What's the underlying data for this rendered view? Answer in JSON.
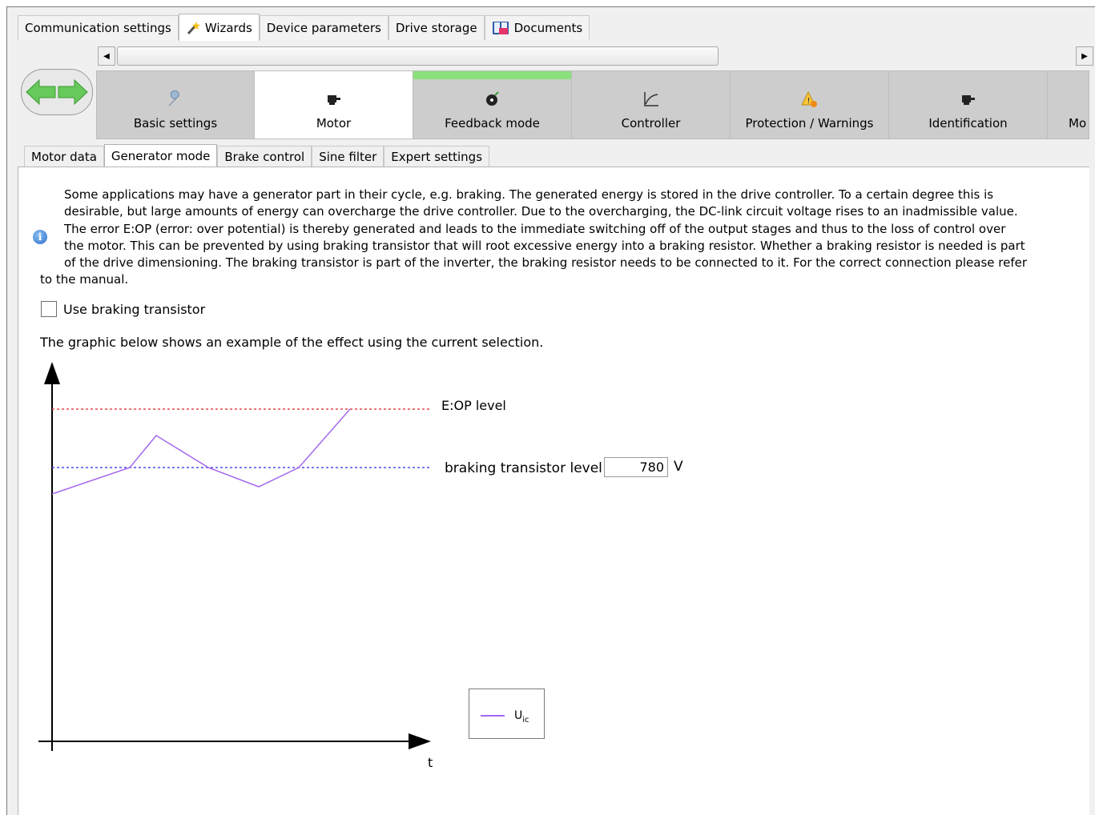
{
  "top_tabs": [
    {
      "label": "Communication settings",
      "icon": "",
      "active": false
    },
    {
      "label": "Wizards",
      "icon": "wand-icon",
      "active": true
    },
    {
      "label": "Device parameters",
      "icon": "",
      "active": false
    },
    {
      "label": "Drive storage",
      "icon": "",
      "active": false
    },
    {
      "label": "Documents",
      "icon": "documents-book-icon",
      "active": false
    }
  ],
  "wizard_steps": [
    {
      "label": "Basic settings",
      "icon": "wrench-icon",
      "state": "normal"
    },
    {
      "label": "Motor",
      "icon": "motor-icon",
      "state": "active"
    },
    {
      "label": "Feedback mode",
      "icon": "encoder-icon",
      "state": "done"
    },
    {
      "label": "Controller",
      "icon": "curve-icon",
      "state": "normal"
    },
    {
      "label": "Protection / Warnings",
      "icon": "warning-icon",
      "state": "normal"
    },
    {
      "label": "Identification",
      "icon": "motor-icon",
      "state": "normal"
    },
    {
      "label": "Mo",
      "icon": "",
      "state": "normal"
    }
  ],
  "sub_tabs": [
    {
      "label": "Motor data",
      "active": false
    },
    {
      "label": "Generator mode",
      "active": true
    },
    {
      "label": "Brake control",
      "active": false
    },
    {
      "label": "Sine filter",
      "active": false
    },
    {
      "label": "Expert settings",
      "active": false
    }
  ],
  "info": {
    "lines": [
      "Some applications may have a generator part in their cycle, e.g. braking. The generated energy is stored in the drive controller. To a certain degree this is",
      "desirable, but large amounts of energy can overcharge the drive controller. Due to the overcharging, the DC-link circuit voltage rises to an inadmissible value.",
      "The error E:OP (error: over potential) is thereby generated and leads to the immediate switching off of the output stages and thus to the loss of control over",
      "the motor. This can be prevented by using braking transistor that will root excessive energy into a braking resistor. Whether a braking resistor is needed is part",
      "of the drive dimensioning. The braking transistor is part of the inverter, the braking resistor needs to be connected to it. For the correct connection please refer",
      "to the manual."
    ]
  },
  "checkbox": {
    "label": "Use braking transistor",
    "checked": false
  },
  "caption": "The graphic below shows an example of the effect using the current selection.",
  "graphic": {
    "eop_label": "E:OP level",
    "brake_label": "braking transistor level",
    "brake_value": "780",
    "unit": "V",
    "x_axis_label": "t",
    "legend_label": "U",
    "legend_sub": "ic",
    "colors": {
      "eop": "#e8474f",
      "brake": "#4d4df0",
      "curve": "#a569ee"
    }
  }
}
